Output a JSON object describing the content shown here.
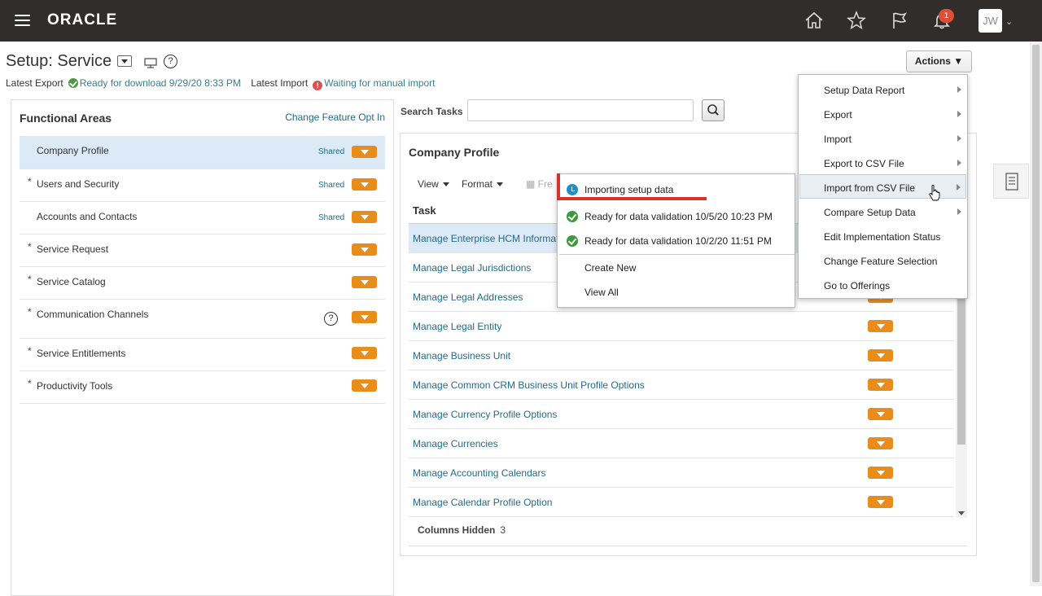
{
  "topbar": {
    "logo": "ORACLE",
    "notification_count": "1",
    "user_initials": "JW"
  },
  "page": {
    "title": "Setup: Service",
    "latest_export_label": "Latest Export",
    "latest_export_status": "Ready for download 9/29/20 8:33 PM",
    "latest_import_label": "Latest Import",
    "latest_import_status": "Waiting for manual import",
    "actions_label": "Actions"
  },
  "functional_areas": {
    "heading": "Functional Areas",
    "change_link": "Change Feature Opt In",
    "items": [
      {
        "star": "",
        "label": "Company Profile",
        "shared": "Shared"
      },
      {
        "star": "*",
        "label": "Users and Security",
        "shared": "Shared"
      },
      {
        "star": "",
        "label": "Accounts and Contacts",
        "shared": "Shared"
      },
      {
        "star": "*",
        "label": "Service Request",
        "shared": ""
      },
      {
        "star": "*",
        "label": "Service Catalog",
        "shared": ""
      },
      {
        "star": "*",
        "label": "Communication Channels",
        "shared": ""
      },
      {
        "star": "*",
        "label": "Service Entitlements",
        "shared": ""
      },
      {
        "star": "*",
        "label": "Productivity Tools",
        "shared": ""
      }
    ]
  },
  "search": {
    "label": "Search Tasks",
    "value": ""
  },
  "company_profile": {
    "title": "Company Profile",
    "toolbar": {
      "view": "View",
      "format": "Format",
      "freeze": "Fre"
    },
    "task_header": "Task",
    "tasks": [
      "Manage Enterprise HCM Informat",
      "Manage Legal Jurisdictions",
      "Manage Legal Addresses",
      "Manage Legal Entity",
      "Manage Business Unit",
      "Manage Common CRM Business Unit Profile Options",
      "Manage Currency Profile Options",
      "Manage Currencies",
      "Manage Accounting Calendars",
      "Manage Calendar Profile Option"
    ],
    "columns_hidden_label": "Columns Hidden",
    "columns_hidden_count": "3"
  },
  "import_popup": {
    "items": [
      {
        "icon": "clock-icon",
        "label": "Importing setup data"
      },
      {
        "icon": "check-icon",
        "label": "Ready for data validation 10/5/20 10:23 PM"
      },
      {
        "icon": "check-icon",
        "label": "Ready for data validation 10/2/20 11:51 PM"
      },
      {
        "icon": "",
        "label": "Create New"
      },
      {
        "icon": "",
        "label": "View All"
      }
    ]
  },
  "actions_menu": {
    "items": [
      {
        "label": "Setup Data Report",
        "submenu": true
      },
      {
        "label": "Export",
        "submenu": true
      },
      {
        "label": "Import",
        "submenu": true
      },
      {
        "label": "Export to CSV File",
        "submenu": true
      },
      {
        "label": "Import from CSV File",
        "submenu": true
      },
      {
        "label": "Compare Setup Data",
        "submenu": true
      },
      {
        "label": "Edit Implementation Status",
        "submenu": false
      },
      {
        "label": "Change Feature Selection",
        "submenu": false
      },
      {
        "label": "Go to Offerings",
        "submenu": false
      }
    ]
  },
  "colors": {
    "topbar": "#312d2a",
    "link": "#226a8a",
    "orange": "#e88d1c",
    "selected": "#dbeaf6"
  }
}
